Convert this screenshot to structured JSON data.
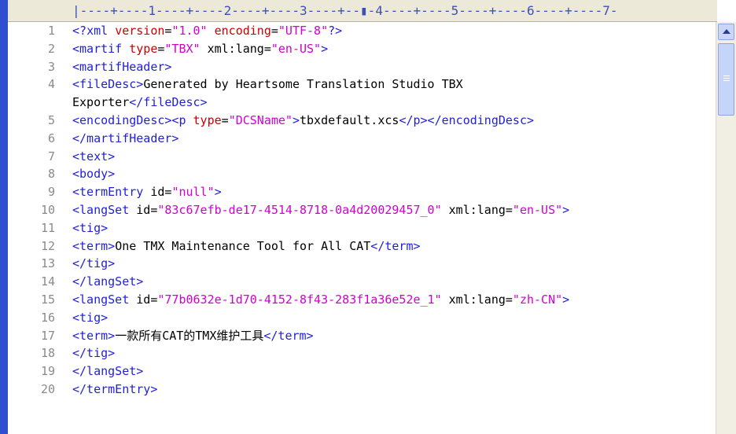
{
  "ruler": {
    "text": "|----+----1----+----2----+----3----+--▮-4----+----5----+----6----+----7-"
  },
  "lines": [
    {
      "n": "1",
      "seg": [
        [
          "t",
          "<?"
        ],
        [
          "t",
          "xml "
        ],
        [
          "a",
          "version"
        ],
        [
          "x",
          "="
        ],
        [
          "v",
          "\"1.0\""
        ],
        [
          "x",
          " "
        ],
        [
          "a",
          "encoding"
        ],
        [
          "x",
          "="
        ],
        [
          "v",
          "\"UTF-8\""
        ],
        [
          "t",
          "?>"
        ]
      ]
    },
    {
      "n": "2",
      "seg": [
        [
          "t",
          "<martif "
        ],
        [
          "a",
          "type"
        ],
        [
          "x",
          "="
        ],
        [
          "v",
          "\"TBX\""
        ],
        [
          "x",
          " xml:lang="
        ],
        [
          "v",
          "\"en-US\""
        ],
        [
          "t",
          ">"
        ]
      ]
    },
    {
      "n": "3",
      "seg": [
        [
          "t",
          "<martifHeader>"
        ]
      ]
    },
    {
      "n": "4",
      "seg": [
        [
          "t",
          "<fileDesc>"
        ],
        [
          "x",
          "Generated by Heartsome Translation Studio TBX"
        ]
      ]
    },
    {
      "n": "",
      "seg": [
        [
          "x",
          "Exporter"
        ],
        [
          "t",
          "</fileDesc>"
        ]
      ]
    },
    {
      "n": "5",
      "seg": [
        [
          "t",
          "<encodingDesc><p "
        ],
        [
          "a",
          "type"
        ],
        [
          "x",
          "="
        ],
        [
          "v",
          "\"DCSName\""
        ],
        [
          "t",
          ">"
        ],
        [
          "x",
          "tbxdefault.xcs"
        ],
        [
          "t",
          "</p></encodingDesc>"
        ]
      ]
    },
    {
      "n": "6",
      "seg": [
        [
          "t",
          "</martifHeader>"
        ]
      ]
    },
    {
      "n": "7",
      "seg": [
        [
          "t",
          "<text>"
        ]
      ]
    },
    {
      "n": "8",
      "seg": [
        [
          "t",
          "<body>"
        ]
      ]
    },
    {
      "n": "9",
      "seg": [
        [
          "t",
          "<termEntry "
        ],
        [
          "x",
          "id="
        ],
        [
          "v",
          "\"null\""
        ],
        [
          "t",
          ">"
        ]
      ]
    },
    {
      "n": "10",
      "seg": [
        [
          "t",
          "<langSet "
        ],
        [
          "x",
          "id="
        ],
        [
          "v",
          "\"83c67efb-de17-4514-8718-0a4d20029457_0\""
        ],
        [
          "x",
          " xml:lang="
        ],
        [
          "v",
          "\"en-US\""
        ],
        [
          "t",
          ">"
        ]
      ]
    },
    {
      "n": "11",
      "seg": [
        [
          "t",
          "<tig>"
        ]
      ]
    },
    {
      "n": "12",
      "seg": [
        [
          "t",
          "<term>"
        ],
        [
          "x",
          "One TMX Maintenance Tool for All CAT"
        ],
        [
          "t",
          "</term>"
        ]
      ]
    },
    {
      "n": "13",
      "seg": [
        [
          "t",
          "</tig>"
        ]
      ]
    },
    {
      "n": "14",
      "seg": [
        [
          "t",
          "</langSet>"
        ]
      ]
    },
    {
      "n": "15",
      "seg": [
        [
          "t",
          "<langSet "
        ],
        [
          "x",
          "id="
        ],
        [
          "v",
          "\"77b0632e-1d70-4152-8f43-283f1a36e52e_1\""
        ],
        [
          "x",
          " xml:lang="
        ],
        [
          "v",
          "\"zh-CN\""
        ],
        [
          "t",
          ">"
        ]
      ]
    },
    {
      "n": "16",
      "seg": [
        [
          "t",
          "<tig>"
        ]
      ]
    },
    {
      "n": "17",
      "seg": [
        [
          "t",
          "<term>"
        ],
        [
          "x",
          "一款所有CAT的TMX维护工具"
        ],
        [
          "t",
          "</term>"
        ]
      ]
    },
    {
      "n": "18",
      "seg": [
        [
          "t",
          "</tig>"
        ]
      ]
    },
    {
      "n": "19",
      "seg": [
        [
          "t",
          "</langSet>"
        ]
      ]
    },
    {
      "n": "20",
      "seg": [
        [
          "t",
          "</termEntry>"
        ]
      ]
    }
  ],
  "colors": {
    "tag": "#1f1fd8",
    "attr": "#cc0000",
    "value": "#d000d0",
    "text": "#000000",
    "border": "#2f4fd0"
  },
  "icons": {
    "scroll_up": "chevron-up-icon",
    "thumb_grip": "grip-icon"
  }
}
